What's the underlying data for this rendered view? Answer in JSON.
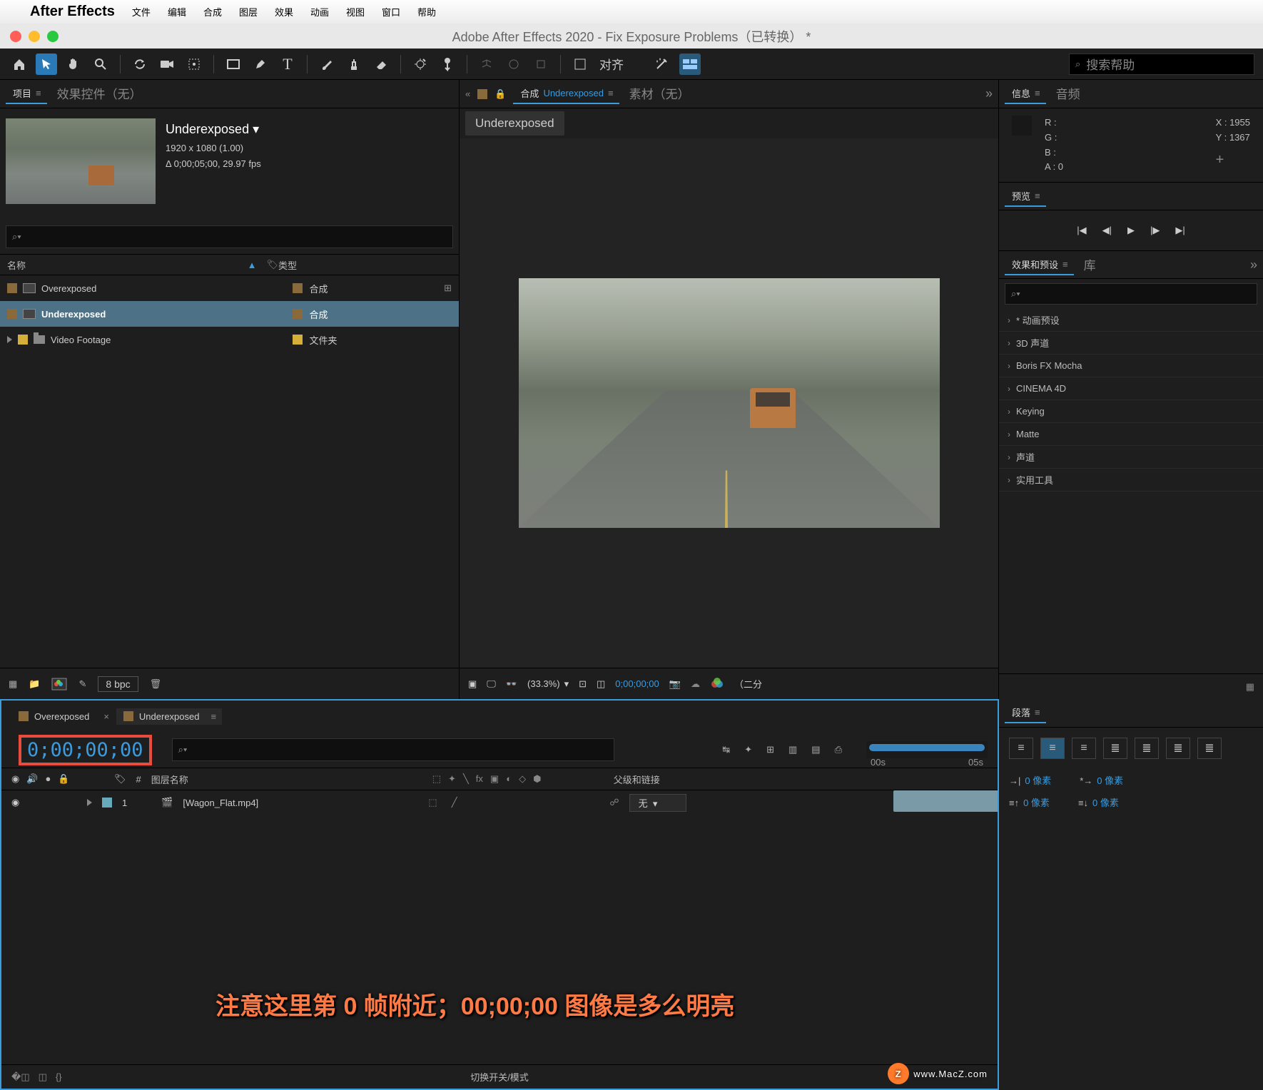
{
  "menubar": {
    "app": "After Effects",
    "items": [
      "文件",
      "编辑",
      "合成",
      "图层",
      "效果",
      "动画",
      "视图",
      "窗口",
      "帮助"
    ]
  },
  "window_title": "Adobe After Effects 2020 - Fix Exposure Problems（已转换） *",
  "toolbar": {
    "align": "对齐",
    "search_placeholder": "搜索帮助"
  },
  "project": {
    "tab_project": "项目",
    "tab_effect_controls": "效果控件（无）",
    "comp_name": "Underexposed ▾",
    "dims": "1920 x 1080 (1.00)",
    "delta": "Δ 0;00;05;00, 29.97 fps",
    "col_name": "名称",
    "col_type": "类型",
    "items": [
      {
        "name": "Overexposed",
        "type": "合成",
        "color": "brown",
        "icon": "comp"
      },
      {
        "name": "Underexposed",
        "type": "合成",
        "color": "brown",
        "icon": "comp",
        "sel": true
      },
      {
        "name": "Video Footage",
        "type": "文件夹",
        "color": "yellow",
        "icon": "folder"
      }
    ],
    "bpc": "8 bpc"
  },
  "composition": {
    "tab_comp_prefix": "合成",
    "tab_comp_name": "Underexposed",
    "tab_footage": "素材（无）",
    "subtab": "Underexposed",
    "zoom": "(33.3%)",
    "timecode": "0;00;00;00",
    "end": "（二分"
  },
  "info": {
    "tab_info": "信息",
    "tab_audio": "音频",
    "r": "R :",
    "g": "G :",
    "b": "B :",
    "a": "A :  0",
    "x": "X : 1955",
    "y": "Y : 1367"
  },
  "preview": {
    "tab": "预览"
  },
  "effects_presets": {
    "tab_ep": "效果和预设",
    "tab_lib": "库",
    "items": [
      "* 动画预设",
      "3D 声道",
      "Boris FX Mocha",
      "CINEMA 4D",
      "Keying",
      "Matte",
      "声道",
      "实用工具"
    ]
  },
  "timeline": {
    "tab1": "Overexposed",
    "tab2": "Underexposed",
    "timecode": "0;00;00;00",
    "ruler_labels": [
      "00s",
      "05s"
    ],
    "col_layer": "图层名称",
    "col_parent": "父级和链接",
    "layer_num": "1",
    "layer_name": "[Wagon_Flat.mp4]",
    "parent_val": "无",
    "footer": "切换开关/模式",
    "hash": "#"
  },
  "paragraph": {
    "tab": "段落",
    "px": "0 像素"
  },
  "callout": "注意这里第 0 帧附近；00;00;00 图像是多么明亮",
  "watermark": "www.MacZ.com",
  "icons": {
    "search": "⌕",
    "lock": "🔒",
    "tag": "🏷",
    "eye": "◉",
    "trash": "🗑",
    "camera": "📷",
    "menu": "≡",
    "close": "×",
    "play": "▶",
    "pause": "❚❚",
    "first": "|◀",
    "prev": "◀|",
    "next": "|▶",
    "last": "▶|",
    "plus": "+",
    "chev_r": "›",
    "chev_dd": "»",
    "folder": "📁",
    "home": "⌂",
    "hand": "✋"
  }
}
